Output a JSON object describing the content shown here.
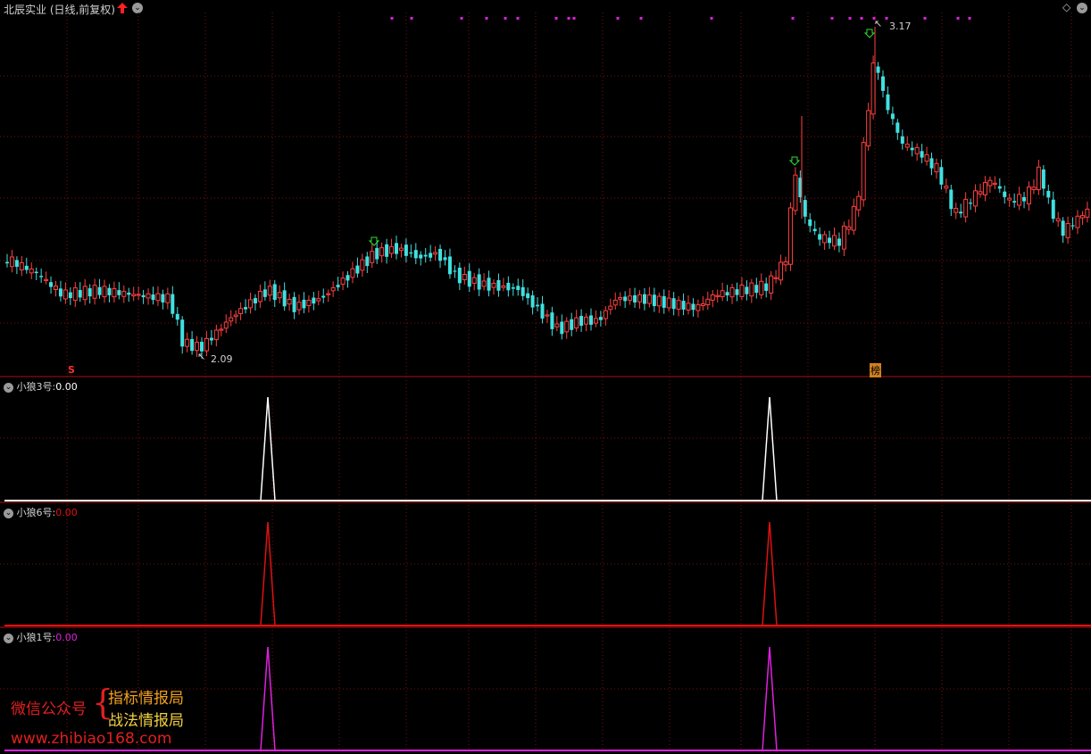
{
  "header": {
    "title": "北辰实业 (日线,前复权)",
    "arrow_color": "#ff2020"
  },
  "main_chart": {
    "high_label": "3.17",
    "low_label": "2.09",
    "marker_s": "S",
    "marker_bang": "榜"
  },
  "indicators": [
    {
      "name": "小狼3号",
      "sep": ":",
      "value": "0.00",
      "color": "#ffffff"
    },
    {
      "name": "小狼6号",
      "sep": ":",
      "value": "0.00",
      "color": "#e01010"
    },
    {
      "name": "小狼1号",
      "sep": ":",
      "value": "0.00",
      "color": "#e020e0"
    }
  ],
  "watermark": {
    "label": "微信公众号",
    "brace": "{",
    "line1": "指标情报局",
    "line2": "战法情报局",
    "url": "www.zhibiao168.com"
  },
  "colors": {
    "up": "#ff4040",
    "down": "#40e0e0",
    "grid": "#7a1010",
    "separator": "#b01010",
    "magenta_dots": "#e020e0"
  }
}
